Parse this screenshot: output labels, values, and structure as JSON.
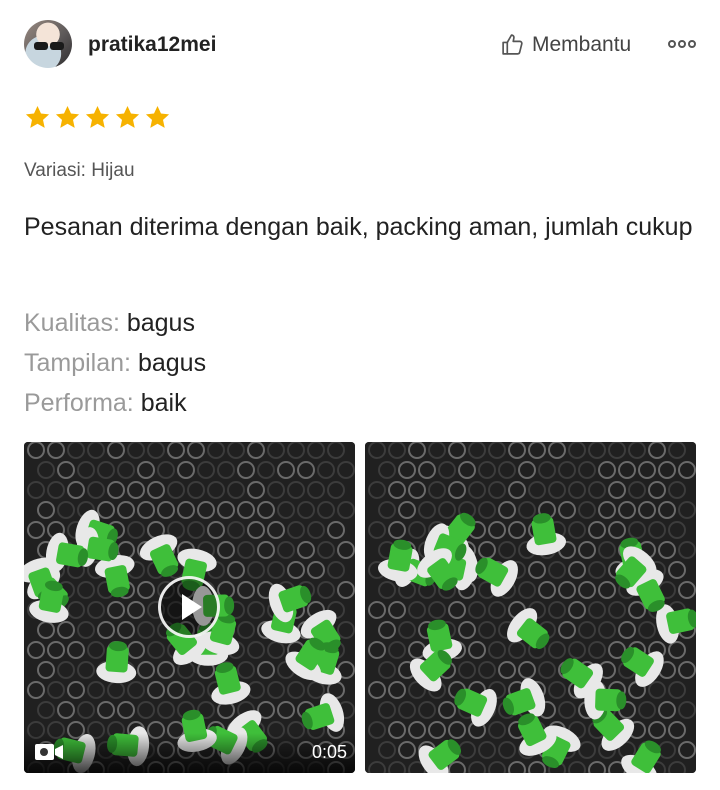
{
  "reviewer": {
    "username": "pratika12mei",
    "avatar_icon": "avatar"
  },
  "actions": {
    "helpful_label": "Membantu",
    "helpful_icon": "thumbs-up-icon",
    "more_icon": "more-options-icon"
  },
  "rating": {
    "stars": 5,
    "max": 5,
    "color": "#F6B200"
  },
  "variation": "Variasi: Hijau",
  "review_text": "Pesanan diterima dengan baik, packing aman, jumlah cukup",
  "attributes": [
    {
      "key": "Kualitas:",
      "value": "bagus"
    },
    {
      "key": "Tampilan:",
      "value": "bagus"
    },
    {
      "key": "Performa:",
      "value": "baik"
    }
  ],
  "media": {
    "video": {
      "duration": "0:05",
      "icon": "video-camera-icon"
    },
    "photo": {
      "icon": "photo"
    }
  },
  "colors": {
    "text": "#222222",
    "muted": "#9A9A9A",
    "part_green": "#3FBF3A",
    "part_white": "#E8E8E8"
  }
}
